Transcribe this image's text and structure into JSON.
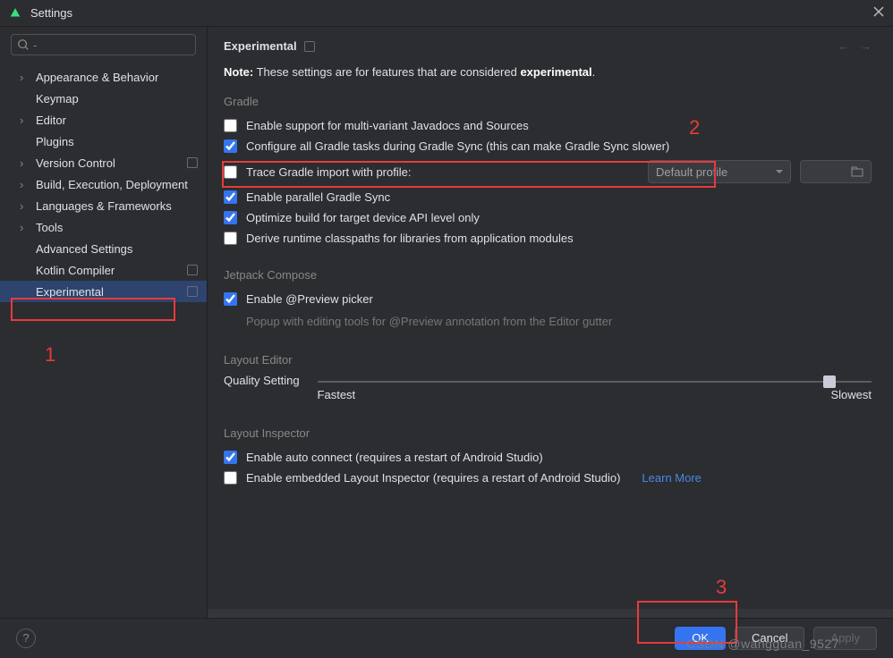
{
  "window": {
    "title": "Settings"
  },
  "search": {
    "placeholder": ""
  },
  "sidebar": {
    "items": [
      {
        "label": "Appearance & Behavior",
        "expandable": true
      },
      {
        "label": "Keymap"
      },
      {
        "label": "Editor",
        "expandable": true
      },
      {
        "label": "Plugins"
      },
      {
        "label": "Version Control",
        "expandable": true,
        "badge": true
      },
      {
        "label": "Build, Execution, Deployment",
        "expandable": true
      },
      {
        "label": "Languages & Frameworks",
        "expandable": true
      },
      {
        "label": "Tools",
        "expandable": true
      },
      {
        "label": "Advanced Settings"
      },
      {
        "label": "Kotlin Compiler",
        "badge": true
      },
      {
        "label": "Experimental",
        "selected": true,
        "badge": true
      }
    ]
  },
  "content": {
    "title": "Experimental",
    "note_prefix": "Note:",
    "note_body": " These settings are for features that are considered ",
    "note_em": "experimental",
    "note_suffix": ".",
    "gradle": {
      "title": "Gradle",
      "opt_javadocs": "Enable support for multi-variant Javadocs and Sources",
      "opt_configure_all": "Configure all Gradle tasks during Gradle Sync (this can make Gradle Sync slower)",
      "opt_trace": "Trace Gradle import with profile:",
      "profile_default": "Default profile",
      "opt_parallel": "Enable parallel Gradle Sync",
      "opt_optimize": "Optimize build for target device API level only",
      "opt_derive": "Derive runtime classpaths for libraries from application modules"
    },
    "jetpack": {
      "title": "Jetpack Compose",
      "opt_preview": "Enable @Preview picker",
      "preview_desc": "Popup with editing tools for @Preview annotation from the Editor gutter"
    },
    "layout_editor": {
      "title": "Layout Editor",
      "quality": "Quality Setting",
      "fastest": "Fastest",
      "slowest": "Slowest"
    },
    "layout_inspector": {
      "title": "Layout Inspector",
      "opt_auto": "Enable auto connect (requires a restart of Android Studio)",
      "opt_embedded": "Enable embedded Layout Inspector (requires a restart of Android Studio)",
      "learn_more": "Learn More"
    }
  },
  "footer": {
    "ok": "OK",
    "cancel": "Cancel",
    "apply": "Apply"
  },
  "annotations": {
    "n1": "1",
    "n2": "2",
    "n3": "3"
  },
  "watermark": "CSDN @wangguan_9527"
}
